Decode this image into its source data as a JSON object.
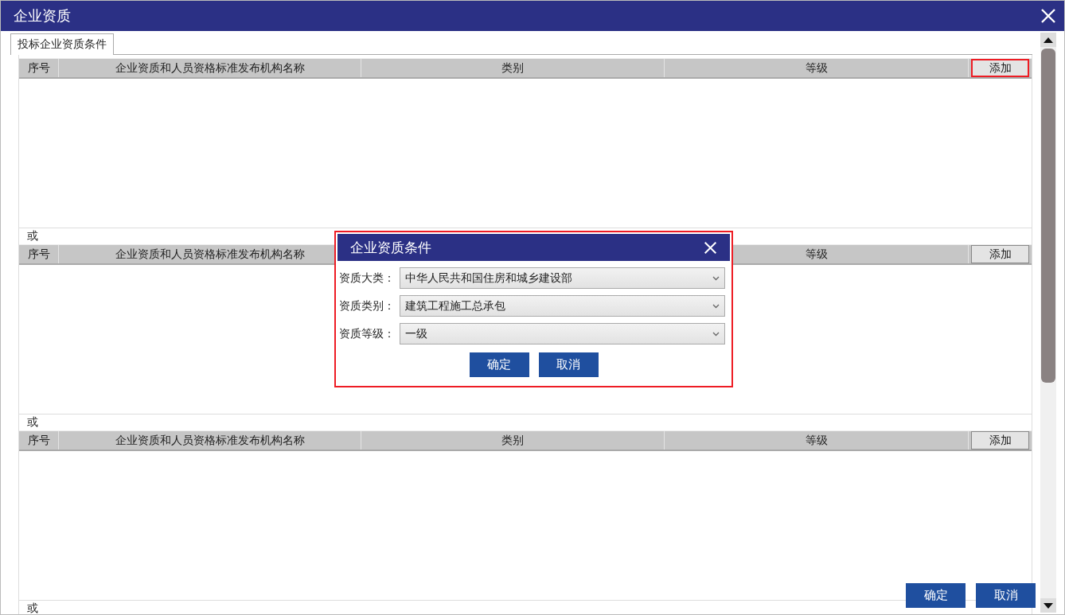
{
  "window": {
    "title": "企业资质"
  },
  "tabs": [
    {
      "label": "投标企业资质条件",
      "selected": true
    }
  ],
  "groups": [
    {
      "columns": [
        "序号",
        "企业资质和人员资格标准发布机构名称",
        "类别",
        "等级"
      ],
      "add_button": {
        "label": "添加",
        "highlighted": true
      },
      "separator": "或"
    },
    {
      "columns": [
        "序号",
        "企业资质和人员资格标准发布机构名称",
        null,
        "等级"
      ],
      "add_button": {
        "label": "添加",
        "highlighted": false
      },
      "separator": "或"
    },
    {
      "columns": [
        "序号",
        "企业资质和人员资格标准发布机构名称",
        "类别",
        "等级"
      ],
      "add_button": {
        "label": "添加",
        "highlighted": false
      },
      "separator": "或"
    }
  ],
  "dialog": {
    "title": "企业资质条件",
    "fields": [
      {
        "label": "资质大类：",
        "value": "中华人民共和国住房和城乡建设部"
      },
      {
        "label": "资质类别：",
        "value": "建筑工程施工总承包"
      },
      {
        "label": "资质等级：",
        "value": "一级"
      }
    ],
    "buttons": [
      "确定",
      "取消"
    ]
  },
  "footer_buttons": [
    "确定",
    "取消"
  ]
}
